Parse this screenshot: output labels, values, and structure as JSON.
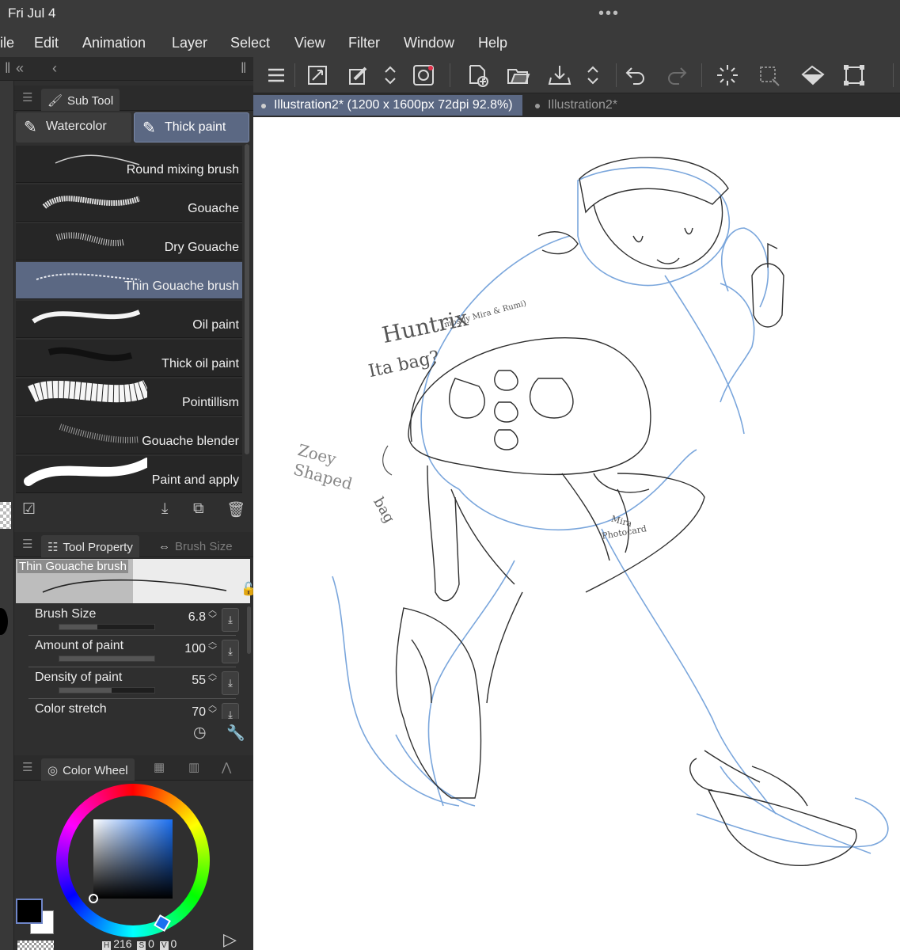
{
  "status": {
    "time": "Fri Jul 4",
    "more": "•••"
  },
  "menu": {
    "items": [
      "ile",
      "Edit",
      "Animation",
      "Layer",
      "Select",
      "View",
      "Filter",
      "Window",
      "Help"
    ]
  },
  "panel_nav": {
    "collapse": "«",
    "back": "‹"
  },
  "subtool": {
    "tab_label": "Sub Tool",
    "groups": [
      "Watercolor",
      "Thick paint"
    ],
    "active_group": "Thick paint",
    "brushes": [
      "Round mixing brush",
      "Gouache",
      "Dry Gouache",
      "Thin Gouache brush",
      "Oil paint",
      "Thick oil paint",
      "Pointillism",
      "Gouache blender",
      "Paint and apply"
    ],
    "selected_brush": "Thin Gouache brush"
  },
  "tool_property": {
    "tab_label": "Tool Property",
    "tab2_label": "Brush Size",
    "brush_name": "Thin Gouache brush",
    "props": [
      {
        "label": "Brush Size",
        "value": "6.8",
        "fill": 0.4
      },
      {
        "label": "Amount of paint",
        "value": "100",
        "fill": 1.0
      },
      {
        "label": "Density of paint",
        "value": "55",
        "fill": 0.55
      },
      {
        "label": "Color stretch",
        "value": "70",
        "fill": 0.7
      }
    ]
  },
  "color_wheel": {
    "tab_label": "Color Wheel",
    "h_tag": "H",
    "h": "216",
    "s_tag": "S",
    "s": "0",
    "v_tag": "V",
    "v": "0",
    "main_color": "#000000",
    "sub_color": "#ffffff",
    "hue_color": "#1b6ff0"
  },
  "tabs": {
    "active": "Illustration2* (1200 x 1600px 72dpi 92.8%)",
    "second": "Illustration2*"
  },
  "canvas_notes": {
    "title": "Huntrix",
    "title_note": "(mostly Mira & Rumi)",
    "subtitle": "Ita bag?",
    "zoey_1": "Zoey",
    "zoey_2": "Shaped",
    "zoey_3": "bag",
    "mira_1": "Mira",
    "mira_2": "Photocard"
  },
  "icons": [
    "menu-icon",
    "fit-icon",
    "edit-icon",
    "updown-icon",
    "record-icon",
    "new-icon",
    "open-icon",
    "save-icon",
    "undo-icon",
    "redo-icon",
    "select-all-icon",
    "deselect-icon",
    "fill-icon",
    "transform-icon"
  ]
}
